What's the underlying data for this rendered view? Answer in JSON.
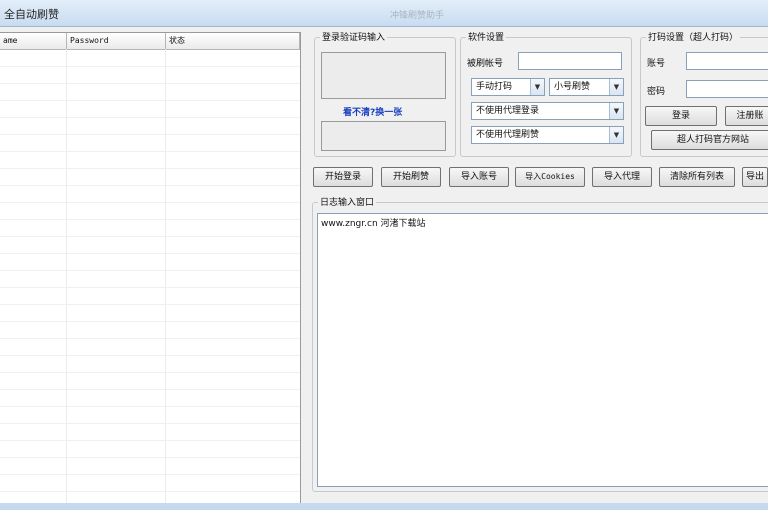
{
  "window": {
    "title": "全自动刷赞",
    "ghost_title": "冲锋刷赞助手"
  },
  "listview": {
    "columns": [
      "ame",
      "Password",
      "状态"
    ],
    "rows": []
  },
  "captcha": {
    "group_label": "登录验证码输入",
    "refresh_link": "看不清?换一张"
  },
  "software_settings": {
    "group_label": "软件设置",
    "brush_account_label": "被刷帐号",
    "brush_account_value": "",
    "mode_select": "手动打码",
    "vote_select": "小号刷赞",
    "login_proxy_select": "不使用代理登录",
    "brush_proxy_select": "不使用代理刷赞"
  },
  "captcha_settings": {
    "group_label": "打码设置（超人打码）",
    "account_label": "账号",
    "account_value": "",
    "password_label": "密码",
    "password_value": "",
    "login_button": "登录",
    "register_button": "注册账",
    "official_site_button": "超人打码官方网站"
  },
  "toolbar": {
    "start_login": "开始登录",
    "start_brush": "开始刷赞",
    "import_accounts": "导入账号",
    "import_cookies": "导入Cookies",
    "import_proxy": "导入代理",
    "clear_lists": "清除所有列表",
    "export": "导出"
  },
  "log": {
    "group_label": "日志输入窗口",
    "lines": [
      "www.zngr.cn  河渚下载站"
    ]
  }
}
